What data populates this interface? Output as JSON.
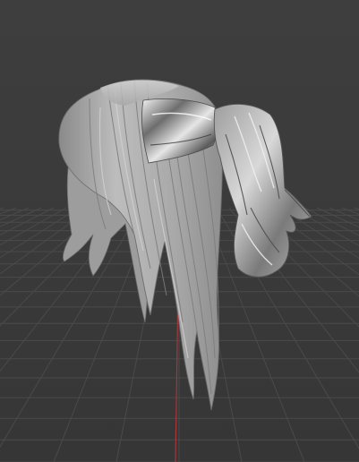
{
  "viewport": {
    "background_color": "#3b3b3b",
    "grid_color": "#4a4a4a",
    "grid_major_color": "#555555",
    "y_axis_color": "#a6363a",
    "model_base_color": "#b4b4b4",
    "model_highlight_color": "#f0f0f0",
    "model_shadow_color": "#5a5a5a"
  },
  "scene": {
    "object": "hair-mesh",
    "view": "perspective",
    "shading": "solid"
  }
}
